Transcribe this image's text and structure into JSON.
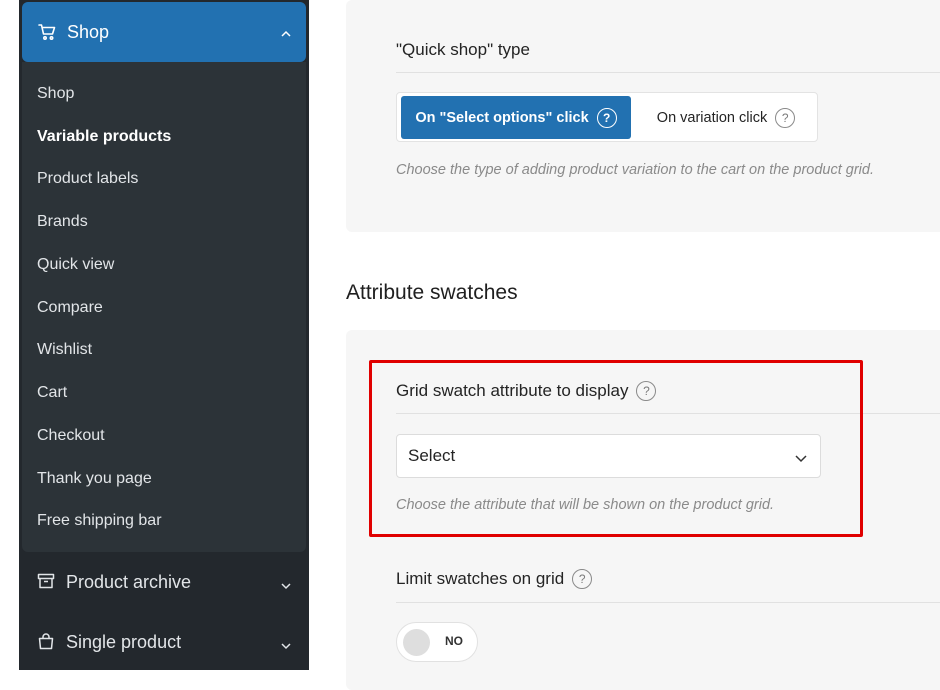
{
  "sidebar": {
    "header": {
      "label": "Shop",
      "icon": "cart-icon"
    },
    "submenu": [
      {
        "label": "Shop",
        "active": false
      },
      {
        "label": "Variable products",
        "active": true
      },
      {
        "label": "Product labels",
        "active": false
      },
      {
        "label": "Brands",
        "active": false
      },
      {
        "label": "Quick view",
        "active": false
      },
      {
        "label": "Compare",
        "active": false
      },
      {
        "label": "Wishlist",
        "active": false
      },
      {
        "label": "Cart",
        "active": false
      },
      {
        "label": "Checkout",
        "active": false
      },
      {
        "label": "Thank you page",
        "active": false
      },
      {
        "label": "Free shipping bar",
        "active": false
      }
    ],
    "groups": [
      {
        "label": "Product archive",
        "icon": "archive-box-icon"
      },
      {
        "label": "Single product",
        "icon": "shopping-bag-icon"
      }
    ]
  },
  "quick_shop": {
    "title": "\"Quick shop\" type",
    "options": [
      {
        "label": "On \"Select options\" click",
        "selected": true,
        "help": "?"
      },
      {
        "label": "On variation click",
        "selected": false,
        "help": "?"
      }
    ],
    "hint": "Choose the type of adding product variation to the cart on the product grid."
  },
  "attribute_swatches": {
    "section_title": "Attribute swatches",
    "grid_attribute": {
      "title": "Grid swatch attribute to display",
      "help": "?",
      "select_value": "Select",
      "hint": "Choose the attribute that will be shown on the product grid."
    },
    "limit_swatches": {
      "title": "Limit swatches on grid",
      "help": "?",
      "toggle_label": "NO",
      "toggle_on": false
    }
  },
  "colors": {
    "accent": "#2271b1",
    "sidebar_bg": "#23282d",
    "highlight": "#e00000"
  }
}
